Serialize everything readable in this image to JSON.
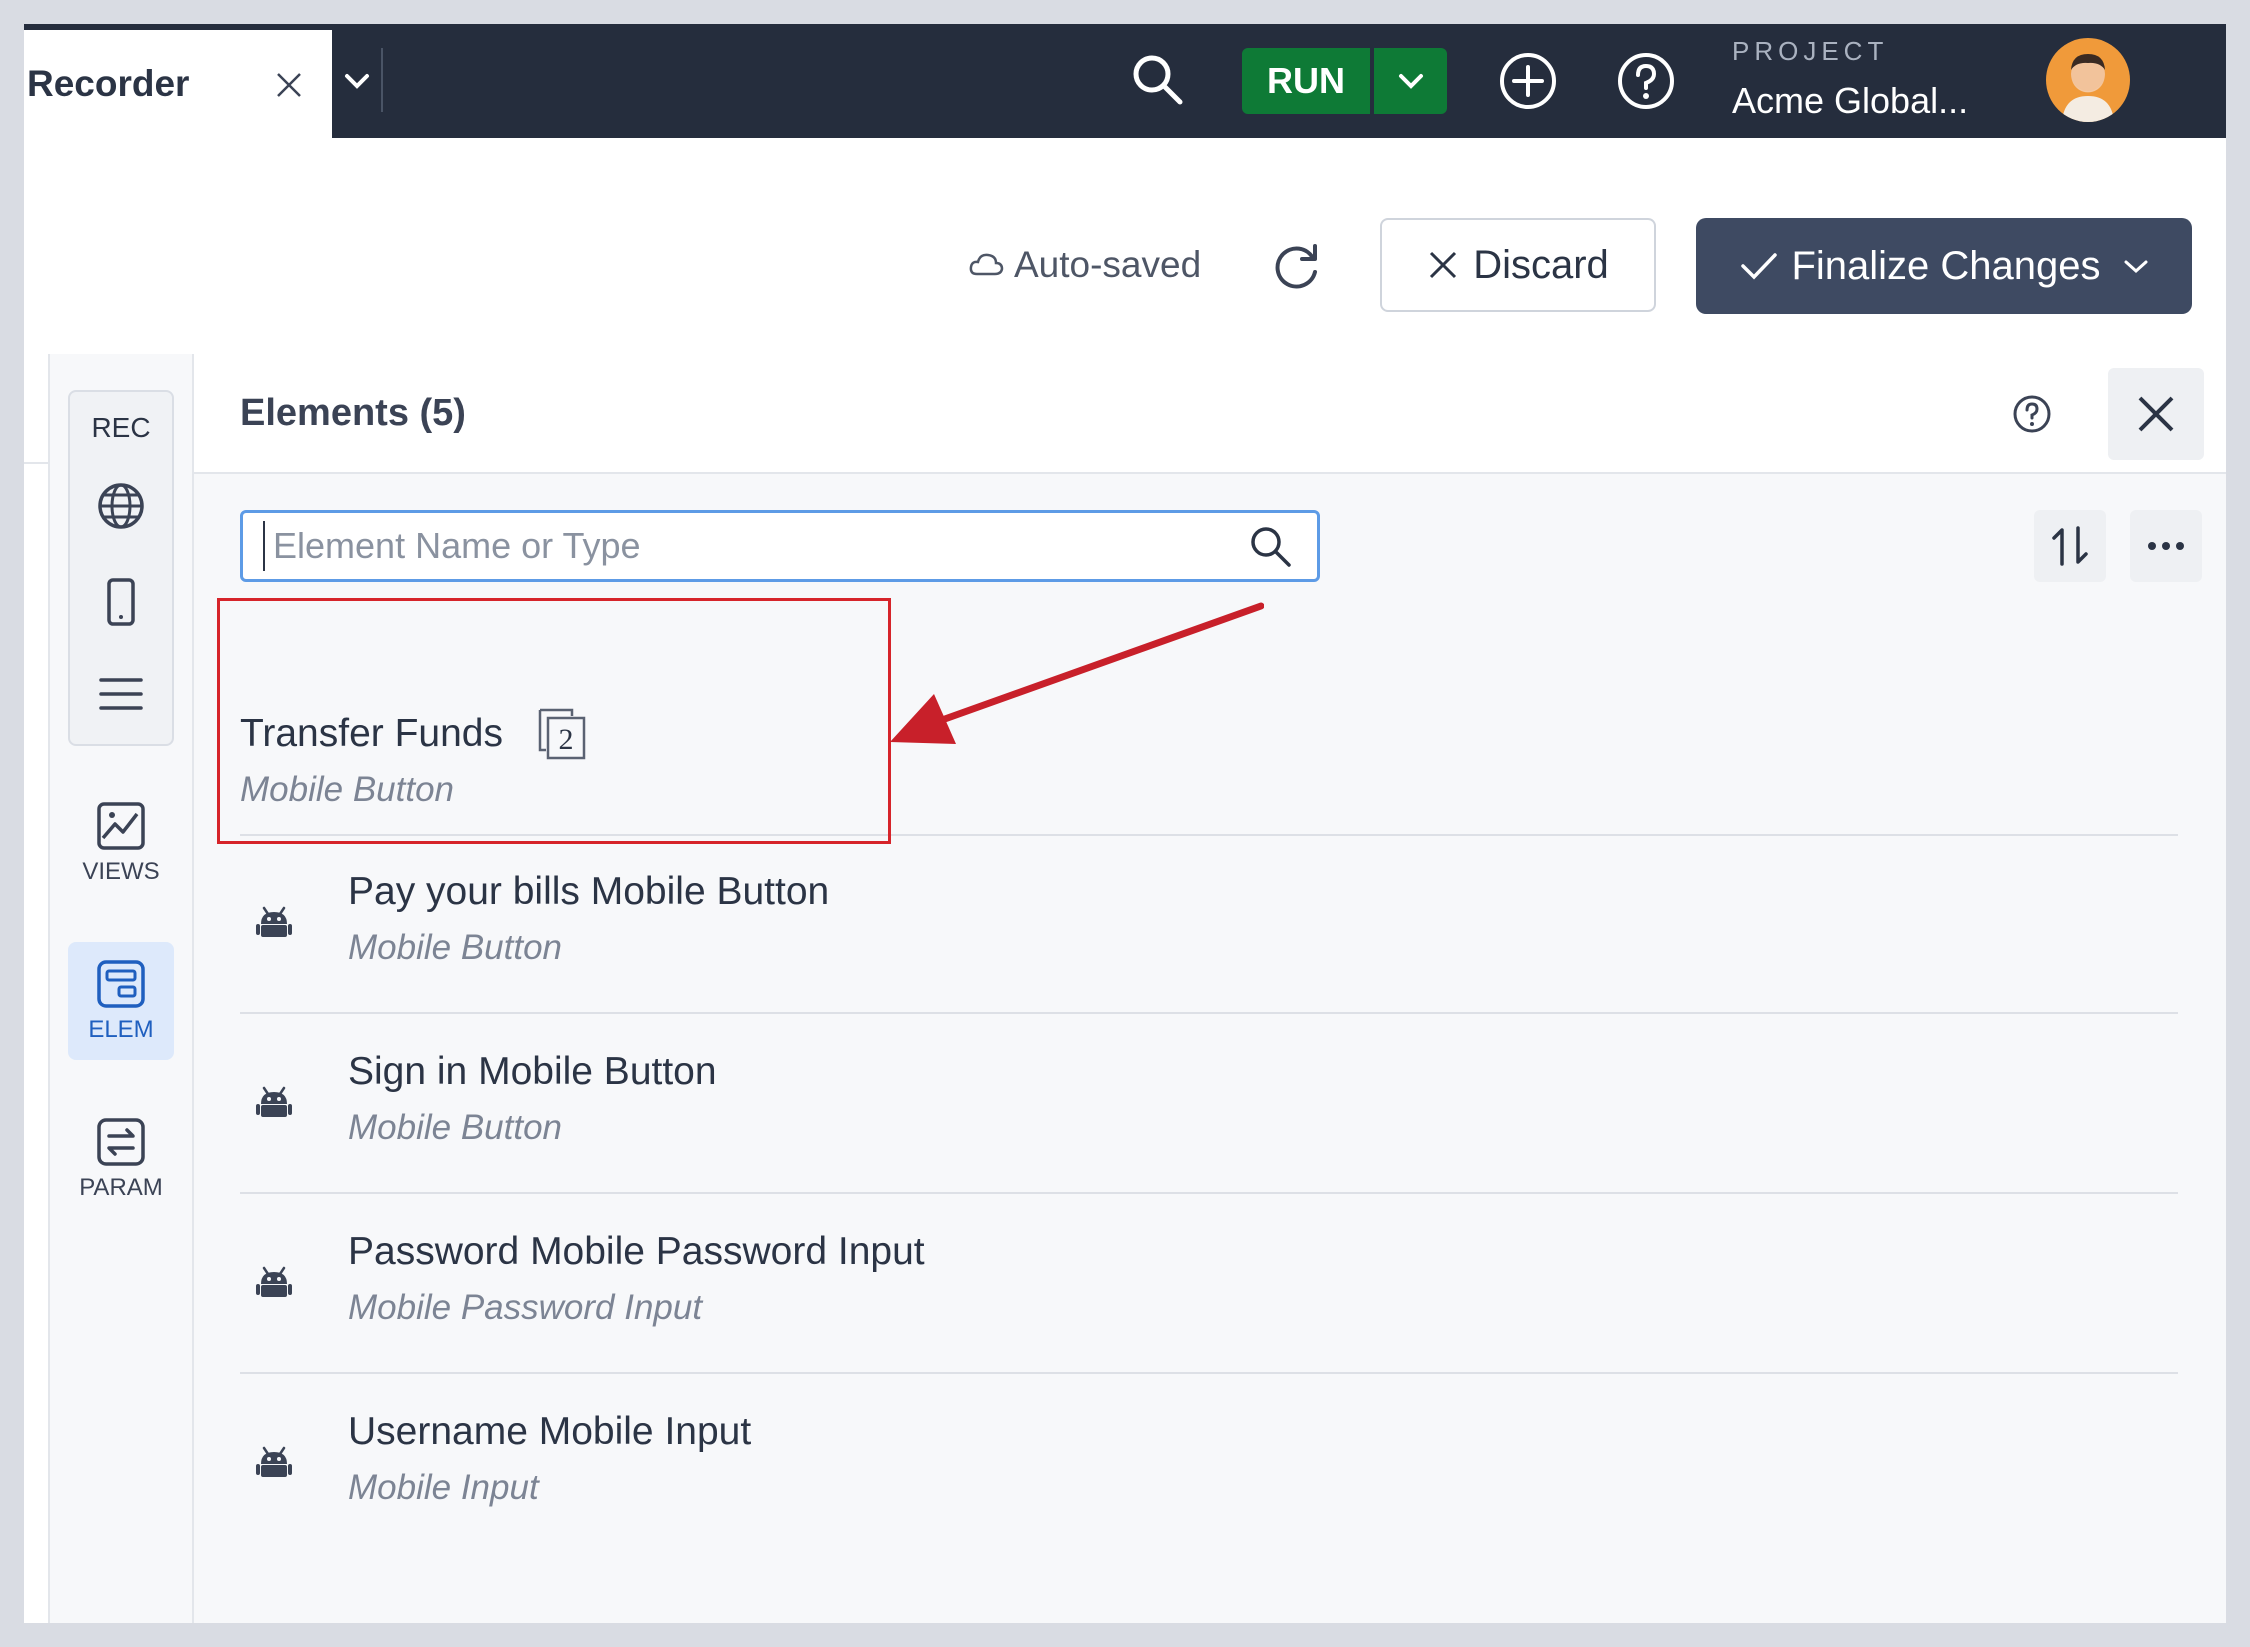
{
  "tab": {
    "title": "Recorder"
  },
  "topbar": {
    "run_label": "RUN",
    "project_label": "PROJECT",
    "project_name": "Acme Global..."
  },
  "actions": {
    "autosaved_label": "Auto-saved",
    "discard_label": "Discard",
    "finalize_label": "Finalize Changes"
  },
  "rail": {
    "rec_label": "REC",
    "views_label": "VIEWS",
    "elem_label": "ELEM",
    "param_label": "PARAM"
  },
  "panel": {
    "title": "Elements (5)",
    "search_placeholder": "Element Name or Type",
    "elements": [
      {
        "name": "Transfer Funds",
        "type": "Mobile Button",
        "count": "2"
      },
      {
        "name": "Pay your bills Mobile Button",
        "type": "Mobile Button"
      },
      {
        "name": "Sign in Mobile Button",
        "type": "Mobile Button"
      },
      {
        "name": "Password Mobile Password Input",
        "type": "Mobile Password Input"
      },
      {
        "name": "Username Mobile Input",
        "type": "Mobile Input"
      }
    ]
  },
  "colors": {
    "topbar_bg": "#252d3d",
    "run_green": "#0e7a36",
    "finalize_bg": "#3e4a62",
    "highlight_red": "#d6242a",
    "active_rail_bg": "#dde9fb",
    "search_border": "#5d9be6"
  },
  "icons": {
    "tab_close": "close-icon",
    "tab_menu": "chevron-down-icon",
    "search": "search-icon",
    "add": "plus-circle-icon",
    "help": "help-circle-icon",
    "autosave": "cloud-icon",
    "refresh": "refresh-icon",
    "globe": "globe-icon",
    "mobile": "mobile-icon",
    "menu": "menu-icon",
    "views": "image-icon",
    "elements": "elements-icon",
    "params": "swap-icon",
    "sort": "sort-icon",
    "more": "more-icon",
    "android": "android-icon",
    "count": "copy-icon"
  }
}
